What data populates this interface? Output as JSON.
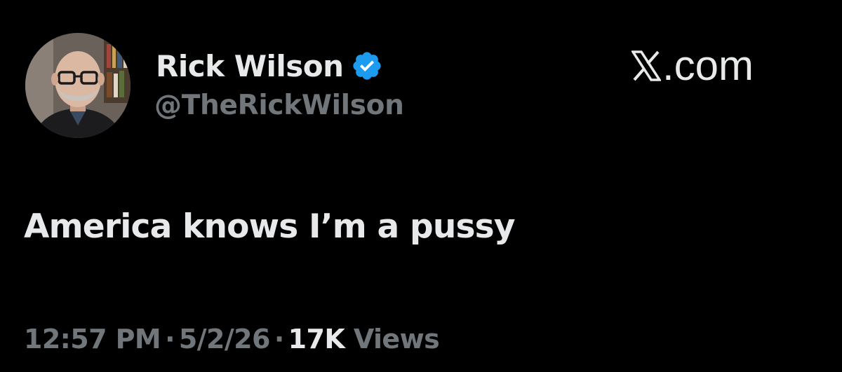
{
  "post": {
    "author": {
      "display_name": "Rick Wilson",
      "handle": "@TheRickWilson",
      "verified_icon": "verified-badge-icon",
      "avatar_icon": "avatar-photo"
    },
    "brand": {
      "logo_icon": "x-logo-icon",
      "text": ".com"
    },
    "text": "America knows I’m a pussy",
    "meta": {
      "time": "12:57 PM",
      "separator": "·",
      "date": "5/2/26",
      "views_count": "17K",
      "views_label": "Views"
    }
  },
  "colors": {
    "background": "#000000",
    "primary_text": "#e7e9ea",
    "secondary_text": "#71767b",
    "verified_blue": "#1d9bf0"
  }
}
